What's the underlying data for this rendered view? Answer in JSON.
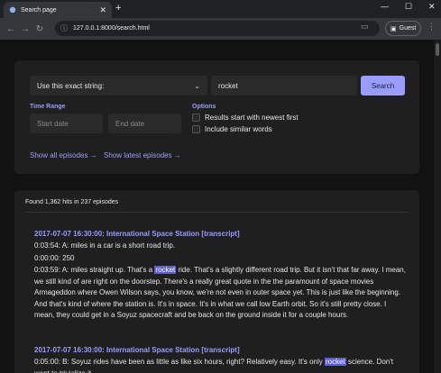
{
  "browser": {
    "tab_title": "Search page",
    "tab_close": "✕",
    "new_tab": "+",
    "url": "127.0.0.1:8000/search.html",
    "profile_label": "Guest",
    "window_controls": [
      "—",
      "☐",
      "✕"
    ]
  },
  "search": {
    "mode_select": "Use this exact string:",
    "query_value": "rocket",
    "search_button": "Search",
    "time_range_label": "Time Range",
    "start_date_placeholder": "Start date",
    "end_date_placeholder": "End date",
    "options_label": "Options",
    "option_newest_first": "Results start with newest first",
    "option_similar_words": "Include similar words",
    "link_all_episodes": "Show all episodes →",
    "link_latest_episodes": "Show latest episodes →"
  },
  "results": {
    "summary": "Found 1,362 hits in 237 episodes",
    "episodes": [
      {
        "title": "2017-07-07 16:30:00: International Space Station [transcript]",
        "lines": [
          {
            "pre": "0:03:54: A: miles in a car is a short road trip.",
            "hl": "",
            "post": ""
          },
          {
            "pre": "0:00:00: 250",
            "hl": "",
            "post": ""
          },
          {
            "pre": "0:03:59: A: miles straight up. That's a ",
            "hl": "rocket",
            "post": " ride. That's a slightly different road trip. But it isn't that far away. I mean, we still kind of are right on the doorstep. There's a really great quote in the the paramount of space movies Armageddon where Owen Wilson says, you know, we're not even in outer space yet. This is just like the beginning. And that's kind of where the station is. It's in space. It's in what we call low Earth orbit. So it's still pretty close. I mean, they could get in a Soyuz spacecraft and be back on the ground inside it for a couple hours."
          }
        ]
      },
      {
        "title": "2017-07-07 16:30:00: International Space Station [transcript]",
        "lines": [
          {
            "pre": "0:05:00: B: Soyuz rides have been as little as like six hours, right? Relatively easy. It's only ",
            "hl": "rocket",
            "post": " science. Don't want to trivialize it."
          }
        ]
      }
    ]
  }
}
